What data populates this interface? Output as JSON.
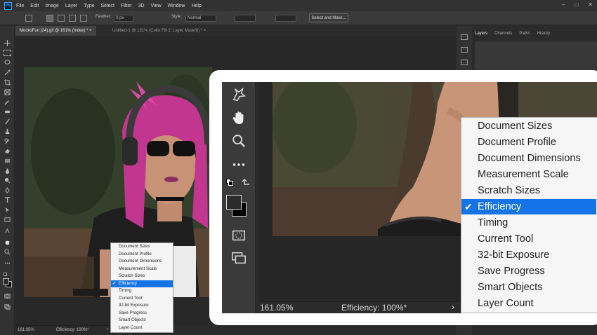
{
  "menubar": {
    "logo": "Ps",
    "items": [
      "File",
      "Edit",
      "Image",
      "Layer",
      "Type",
      "Select",
      "Filter",
      "3D",
      "View",
      "Window",
      "Help"
    ],
    "window_controls": [
      "–",
      "□",
      "✕"
    ]
  },
  "options": {
    "feather_label": "Feather:",
    "feather_value": "0 px",
    "style_label": "Style:",
    "style_value": "Normal",
    "select_mask_label": "Select and Mask..."
  },
  "tabs": [
    {
      "label": "MockoFun (24).gif @ 161% (Index) *  ×",
      "active": true
    },
    {
      "label": "Untitled-1 @ 131% (Color Fill 2, Layer Mask/8) *  ×",
      "active": false
    }
  ],
  "panels": {
    "tabs": [
      "Layers",
      "Channels",
      "Paths",
      "History"
    ]
  },
  "status": {
    "zoom": "161.05%",
    "info": "Efficiency: 100%*",
    "chevron": "›"
  },
  "status_menu": {
    "items": [
      "Document Sizes",
      "Document Profile",
      "Document Dimensions",
      "Measurement Scale",
      "Scratch Sizes",
      "Efficiency",
      "Timing",
      "Current Tool",
      "32-bit Exposure",
      "Save Progress",
      "Smart Objects",
      "Layer Count"
    ],
    "selected_index": 5,
    "check_glyph": "✔"
  },
  "colors": {
    "accent": "#1473e6",
    "foreground_swatch": "#2b2b2b",
    "background_swatch": "#000000"
  }
}
